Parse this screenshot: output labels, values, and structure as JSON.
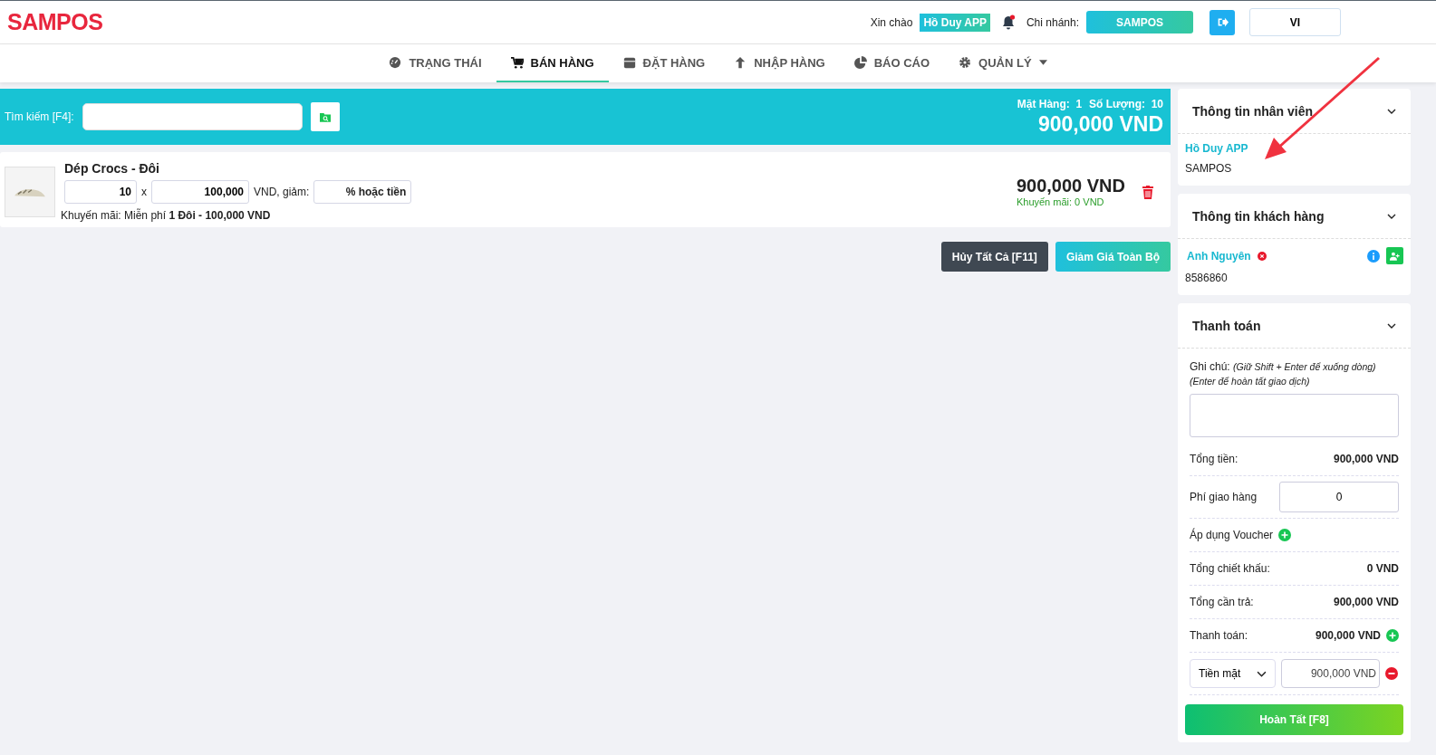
{
  "header": {
    "logo": "SAMPOS",
    "greeting": "Xin chào",
    "user": "Hồ Duy APP",
    "notification": true,
    "branch_label": "Chi nhánh:",
    "branch": "SAMPOS",
    "language": "VI"
  },
  "nav": [
    {
      "label": "TRẠNG THÁI",
      "kind": "gauge",
      "selected": false,
      "dropdown": false
    },
    {
      "label": "BÁN HÀNG",
      "kind": "cart",
      "selected": true,
      "dropdown": false
    },
    {
      "label": "ĐẶT HÀNG",
      "kind": "box",
      "selected": false,
      "dropdown": false
    },
    {
      "label": "NHẬP HÀNG",
      "kind": "upload",
      "selected": false,
      "dropdown": false
    },
    {
      "label": "BÁO CÁO",
      "kind": "pie",
      "selected": false,
      "dropdown": false
    },
    {
      "label": "QUẢN LÝ",
      "kind": "gear",
      "selected": false,
      "dropdown": true
    }
  ],
  "search": {
    "label": "Tìm kiếm [F4]:",
    "item_count_label": "Mặt Hàng:",
    "item_count": "1",
    "quantity_label": "Số Lượng:",
    "quantity": "10",
    "total": "900,000 VND"
  },
  "cart": [
    {
      "name": "Dép Crocs - Đôi",
      "quantity": "10",
      "times": "x",
      "price": "100,000",
      "price_suffix": "VND, giảm:",
      "discount_placeholder": "% hoặc tiền",
      "promo": "Khuyến mãi: Miễn phí **1 Đôi - 100,000 VND**",
      "line_total": "900,000 VND",
      "line_promo": "Khuyến mãi: 0 VND"
    }
  ],
  "actions": [
    "Hủy Tất Cả [F11]",
    "Giảm Giá Toàn Bộ"
  ],
  "employee": {
    "title": "Thông tin nhân viên",
    "name": "Hồ Duy APP",
    "branch": "SAMPOS"
  },
  "customer": {
    "title": "Thông tin khách hàng",
    "name": "Anh Nguyên",
    "phone": "8586860"
  },
  "payment": {
    "title": "Thanh toán",
    "note_label": "Ghi chú:",
    "note_hint": "(Giữ Shift + Enter để xuống dòng) (Enter để hoàn tất giao dịch)",
    "rows": [
      {
        "kind": "total",
        "label": "Tổng tiền:",
        "value": "900,000 VND"
      },
      {
        "kind": "input",
        "label": "Phí giao hàng",
        "value": "0"
      },
      {
        "kind": "add",
        "label": "Áp dụng Voucher"
      },
      {
        "kind": "total",
        "label": "Tổng chiết khấu:",
        "value": "0 VND"
      },
      {
        "kind": "total",
        "label": "Tổng cần trả:",
        "value": "900,000 VND"
      },
      {
        "kind": "total-add",
        "label": "Thanh toán:",
        "value": "900,000 VND"
      },
      {
        "kind": "method",
        "label": "Tiền mặt",
        "value": "900,000",
        "unit": "VND"
      }
    ],
    "submit": "Hoàn Tất [F8]"
  }
}
